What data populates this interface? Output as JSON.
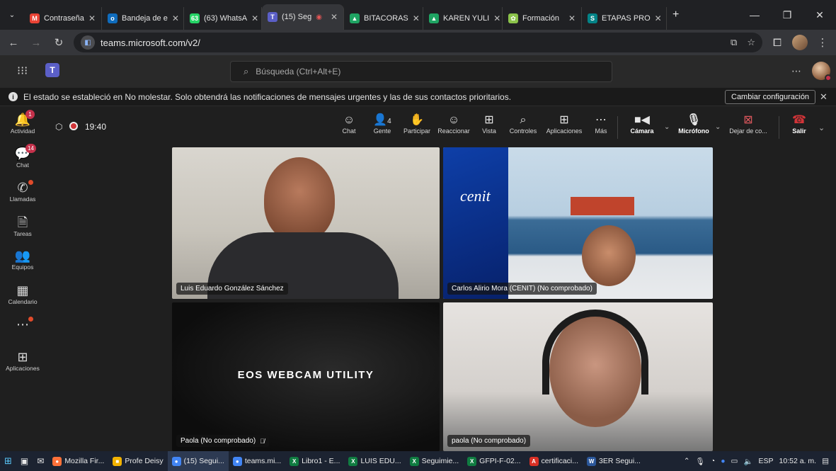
{
  "browser": {
    "tabs": [
      {
        "label": "Contraseña",
        "icon": "gmail-icon",
        "color": "#ea4335",
        "glyph": "M"
      },
      {
        "label": "Bandeja de e",
        "icon": "outlook-icon",
        "color": "#0f6cbd",
        "glyph": "o"
      },
      {
        "label": "(63) WhatsA",
        "icon": "whatsapp-icon",
        "color": "#25d366",
        "glyph": "63"
      },
      {
        "label": "(15) Seg",
        "icon": "teams-icon",
        "color": "#5b5fc7",
        "glyph": "T",
        "active": true
      },
      {
        "label": "BITACORAS",
        "icon": "drive-icon",
        "color": "#1fa463",
        "glyph": "▲"
      },
      {
        "label": "KAREN YULI",
        "icon": "drive-icon",
        "color": "#1fa463",
        "glyph": "▲"
      },
      {
        "label": "Formación",
        "icon": "leaf-icon",
        "color": "#8bc34a",
        "glyph": "✿"
      },
      {
        "label": "ETAPAS PRO",
        "icon": "sharepoint-icon",
        "color": "#038387",
        "glyph": "S"
      }
    ],
    "url": "teams.microsoft.com/v2/"
  },
  "teams": {
    "search_placeholder": "Búsqueda (Ctrl+Alt+E)"
  },
  "banner": {
    "text": "El estado se estableció en No molestar. Solo obtendrá las notificaciones de mensajes urgentes y las de sus contactos prioritarios.",
    "button": "Cambiar configuración"
  },
  "rail": [
    {
      "label": "Actividad",
      "icon": "bell-icon",
      "glyph": "🔔",
      "badge": "1"
    },
    {
      "label": "Chat",
      "icon": "chat-icon",
      "glyph": "💬",
      "badge": "14"
    },
    {
      "label": "Llamadas",
      "icon": "phone-icon",
      "glyph": "✆",
      "dot": true
    },
    {
      "label": "Tareas",
      "icon": "tasks-icon",
      "glyph": "🗎"
    },
    {
      "label": "Equipos",
      "icon": "teams-group-icon",
      "glyph": "👥"
    },
    {
      "label": "Calendario",
      "icon": "calendar-icon",
      "glyph": "▦"
    },
    {
      "label": "",
      "icon": "more-icon",
      "glyph": "⋯",
      "dot": true
    },
    {
      "label": "Aplicaciones",
      "icon": "apps-icon",
      "glyph": "⊞"
    }
  ],
  "meeting": {
    "timer": "19:40",
    "people_count": "4",
    "toolbar": {
      "chat": "Chat",
      "people": "Gente",
      "raise": "Participar",
      "react": "Reaccionar",
      "view": "Vista",
      "controls": "Controles",
      "apps": "Aplicaciones",
      "more": "Más",
      "camera": "Cámara",
      "mic": "Micrófono",
      "share": "Dejar de co...",
      "leave": "Salir"
    },
    "participants": [
      {
        "name": "Luis Eduardo González Sánchez"
      },
      {
        "name": "Carlos Alirio Mora (CENIT) (No comprobado)",
        "logo": "cenit"
      },
      {
        "name": "Paola (No comprobado)",
        "muted": true,
        "content": "EOS WEBCAM UTILITY"
      },
      {
        "name": "paola (No comprobado)"
      }
    ]
  },
  "taskbar": {
    "items": [
      {
        "label": "Mozilla Fir...",
        "icon": "firefox-icon",
        "color": "#ff7139",
        "glyph": "●"
      },
      {
        "label": "Profe Deisy",
        "icon": "folder-icon",
        "color": "#f2b200",
        "glyph": "■"
      },
      {
        "label": "(15) Segui...",
        "icon": "chrome-icon",
        "color": "#4285f4",
        "glyph": "●",
        "active": true
      },
      {
        "label": "teams.mi...",
        "icon": "chrome-icon",
        "color": "#4285f4",
        "glyph": "●"
      },
      {
        "label": "Libro1 - E...",
        "icon": "excel-icon",
        "color": "#107c41",
        "glyph": "X"
      },
      {
        "label": "LUIS EDU...",
        "icon": "excel-icon",
        "color": "#107c41",
        "glyph": "X"
      },
      {
        "label": "Seguimie...",
        "icon": "excel-icon",
        "color": "#107c41",
        "glyph": "X"
      },
      {
        "label": "GFPI-F-02...",
        "icon": "excel-icon",
        "color": "#107c41",
        "glyph": "X"
      },
      {
        "label": "certificaci...",
        "icon": "pdf-icon",
        "color": "#d93025",
        "glyph": "A"
      },
      {
        "label": "3ER Segui...",
        "icon": "word-icon",
        "color": "#2b579a",
        "glyph": "W"
      }
    ],
    "language": "ESP",
    "time": "10:52 a. m."
  }
}
